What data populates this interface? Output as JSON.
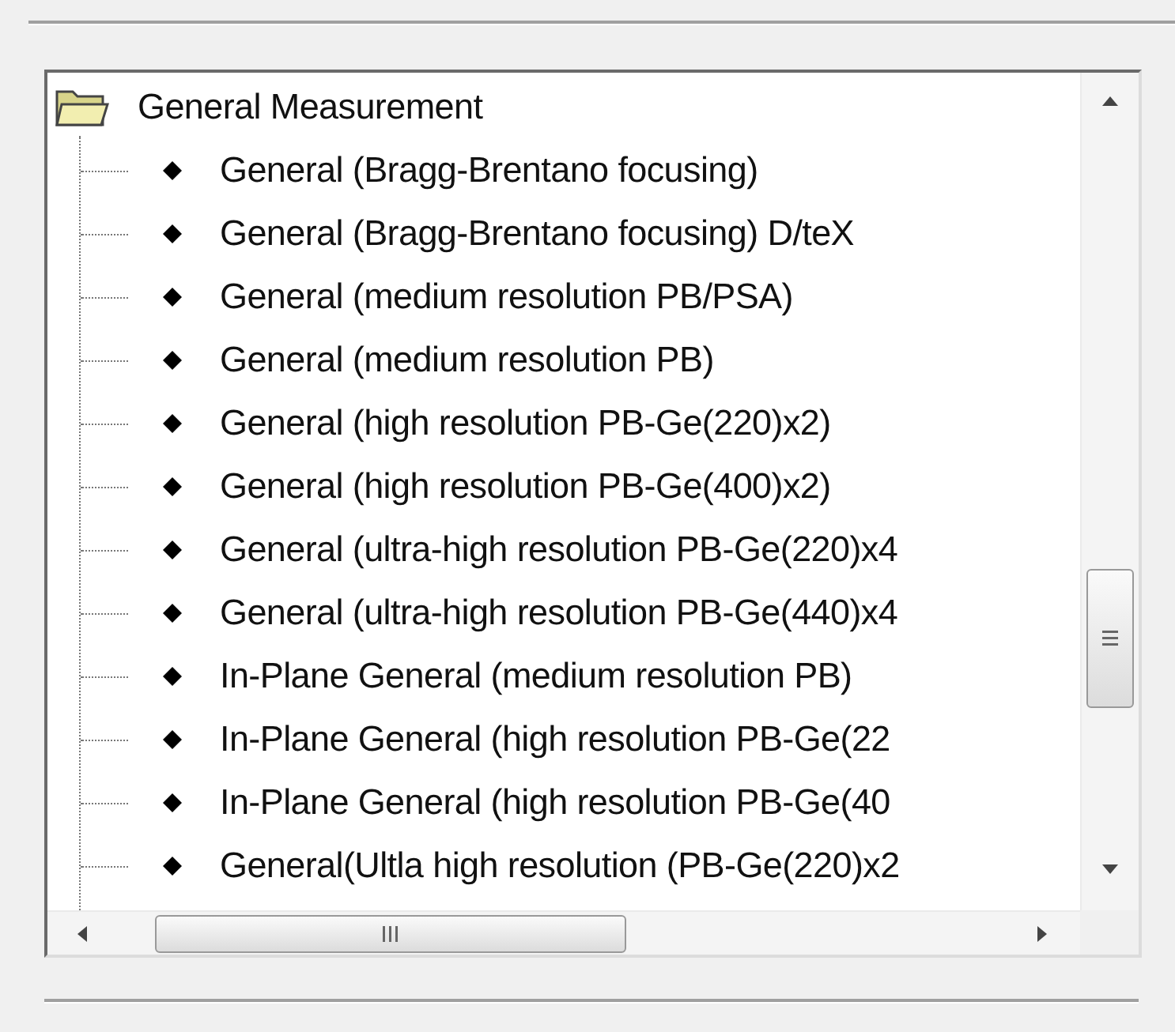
{
  "tree": {
    "label": "General Measurement",
    "expanded": true,
    "children": [
      {
        "label": "General (Bragg-Brentano focusing)"
      },
      {
        "label": "General (Bragg-Brentano focusing) D/teX"
      },
      {
        "label": "General (medium resolution PB/PSA)"
      },
      {
        "label": "General (medium resolution PB)"
      },
      {
        "label": "General (high resolution PB-Ge(220)x2)"
      },
      {
        "label": "General (high resolution PB-Ge(400)x2)"
      },
      {
        "label": "General (ultra-high resolution PB-Ge(220)x4"
      },
      {
        "label": "General (ultra-high resolution PB-Ge(440)x4"
      },
      {
        "label": "In-Plane General (medium resolution PB)"
      },
      {
        "label": "In-Plane General (high resolution PB-Ge(22"
      },
      {
        "label": "In-Plane General (high resolution PB-Ge(40"
      },
      {
        "label": "General(Ultla high resolution (PB-Ge(220)x2"
      }
    ]
  }
}
